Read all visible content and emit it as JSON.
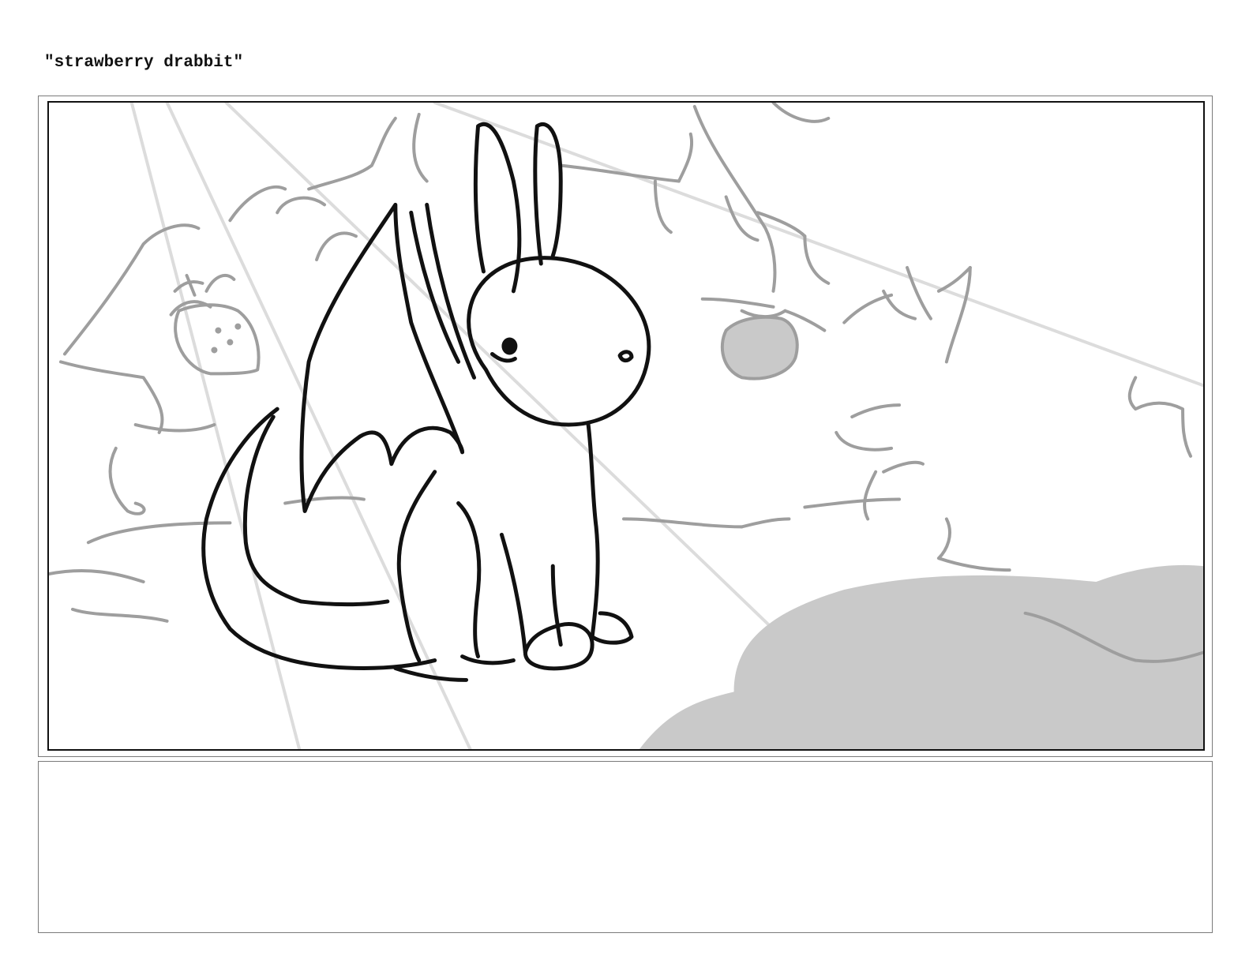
{
  "page": {
    "title": "\"strawberry drabbit\""
  },
  "panel": {
    "subject": "drabbit",
    "sketch_line_color": "#111111",
    "background_line_color": "#9a9a9a",
    "light_ray_color": "#d8d8d8",
    "shadow_fill_color": "#c8c8c8"
  },
  "notes": {
    "text": ""
  }
}
